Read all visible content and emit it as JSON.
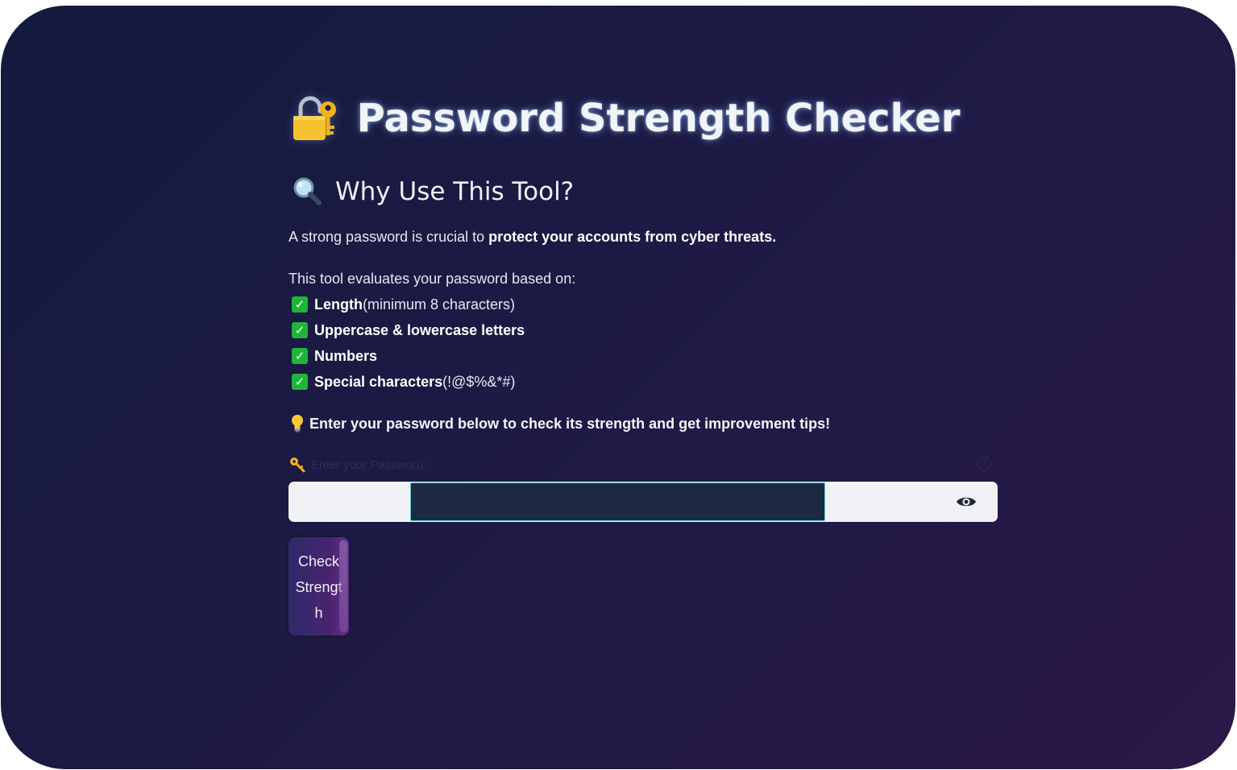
{
  "app": {
    "title": "Password Strength Checker",
    "title_icon": "unlocked-padlock-with-key-icon"
  },
  "intro": {
    "heading": "Why Use This Tool?",
    "heading_icon": "magnifying-glass-icon",
    "line1_prefix": "A strong password is crucial to ",
    "line1_bold": "protect your accounts from cyber threats.",
    "line2": "This tool evaluates your password based on:",
    "criteria": [
      {
        "bold": "Length",
        "rest": " (minimum 8 characters)"
      },
      {
        "bold": "Uppercase & lowercase letters",
        "rest": ""
      },
      {
        "bold": "Numbers",
        "rest": ""
      },
      {
        "bold": "Special characters",
        "rest": " (!@$%&*#)"
      }
    ],
    "check_icon": "green-check-box-icon",
    "tip_icon": "light-bulb-icon",
    "tip": "Enter your password below to check its strength and get improvement tips!"
  },
  "password_input": {
    "label_icon": "key-icon",
    "label": "Enter your Password:",
    "value": "",
    "help_icon": "question-circle-icon",
    "visibility_icon": "eye-icon"
  },
  "check_button": {
    "label": "Check Strength"
  },
  "colors": {
    "background_start": "#141a3d",
    "background_end": "#2a1848",
    "check_green": "#1fb53a",
    "input_bg": "#1c2940",
    "input_border": "#59c9c9",
    "button_gradient_start": "#2d2a6a",
    "button_gradient_end": "#6a2e90"
  }
}
